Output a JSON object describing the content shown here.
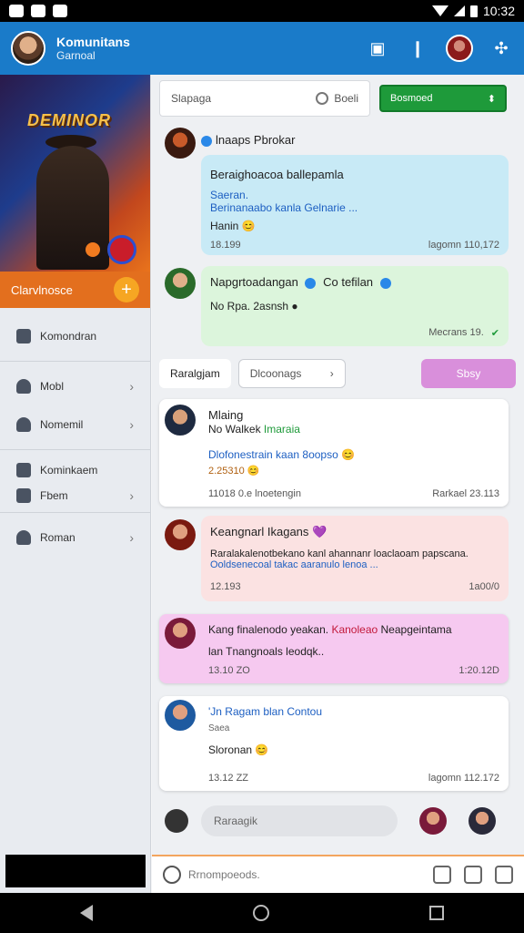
{
  "status": {
    "time": "10:32"
  },
  "appbar": {
    "title": "Komunitans",
    "subtitle": "Garnoal"
  },
  "sidebar": {
    "cta_label": "Clarvlnosce",
    "items": [
      {
        "label": "Komondran",
        "icon": "document-icon",
        "chevron": false
      },
      {
        "label": "Mobl",
        "icon": "person-icon",
        "chevron": true
      },
      {
        "label": "Nomemil",
        "icon": "settings-person-icon",
        "chevron": true
      },
      {
        "label": "Kominkaem",
        "icon": "document-icon",
        "chevron": false
      },
      {
        "label": "Fbem",
        "icon": "bookmark-icon",
        "chevron": true
      },
      {
        "label": "Roman",
        "icon": "person-icon",
        "chevron": true
      }
    ]
  },
  "toolbar": {
    "search_placeholder": "Slapaga",
    "search_hint": "Boeli",
    "primary_label": "Bosmoed"
  },
  "feed": {
    "post1": {
      "name": "lnaaps Pbrokar",
      "l1": "Beraighoacoa ballepamla",
      "l2": "Saeran.",
      "l3": "Berinanaabo kanla Gelnarie ...",
      "l4": "Hanin 😊",
      "time": "18.199",
      "date": "lagomn 110,172"
    },
    "post2": {
      "name": "Napgrtoadangan",
      "name2": "Co tefilan",
      "l1": "No Rpa. 2asnsh ●",
      "date": "Mecrans 19."
    },
    "filters": {
      "active": "Raralgjam",
      "dropdown": "Dlcoonags",
      "action": "Sbsy"
    },
    "post3": {
      "name": "Mlaing",
      "l1": "No Walkek",
      "l1b": "Imaraia",
      "l2": "Dlofonestrain kaan 8oopso 😊",
      "l3": "2.25310 😊",
      "time": "11018 0.e lnoetengin",
      "date": "Rarkael 23.113"
    },
    "post4": {
      "name": "Keangnarl Ikagans 💜",
      "l1": "Raralakalenotbekano kanl ahannanr loaclaoam papscana.",
      "l2": "Ooldsenecoal takac aaranulo lenoa ...",
      "time": "12.193",
      "date": "1a00/0"
    },
    "post5": {
      "name_a": "Kang finalenodo yeakan.",
      "name_b": "Kanoleao",
      "name_c": "Neapgeintama",
      "l1": "lan Tnangnoals leodqk..",
      "time": "13.10 ZO",
      "date": "1:20.12D"
    },
    "post6": {
      "name": "'Jn Ragam blan Contou",
      "sub": "Saea",
      "l1": "Sloronan 😊",
      "time": "13.12 ZZ",
      "date": "lagomn 112.172"
    }
  },
  "composer": {
    "placeholder": "Raraagik"
  },
  "bottombar": {
    "hint": "Rrnompoeods."
  }
}
